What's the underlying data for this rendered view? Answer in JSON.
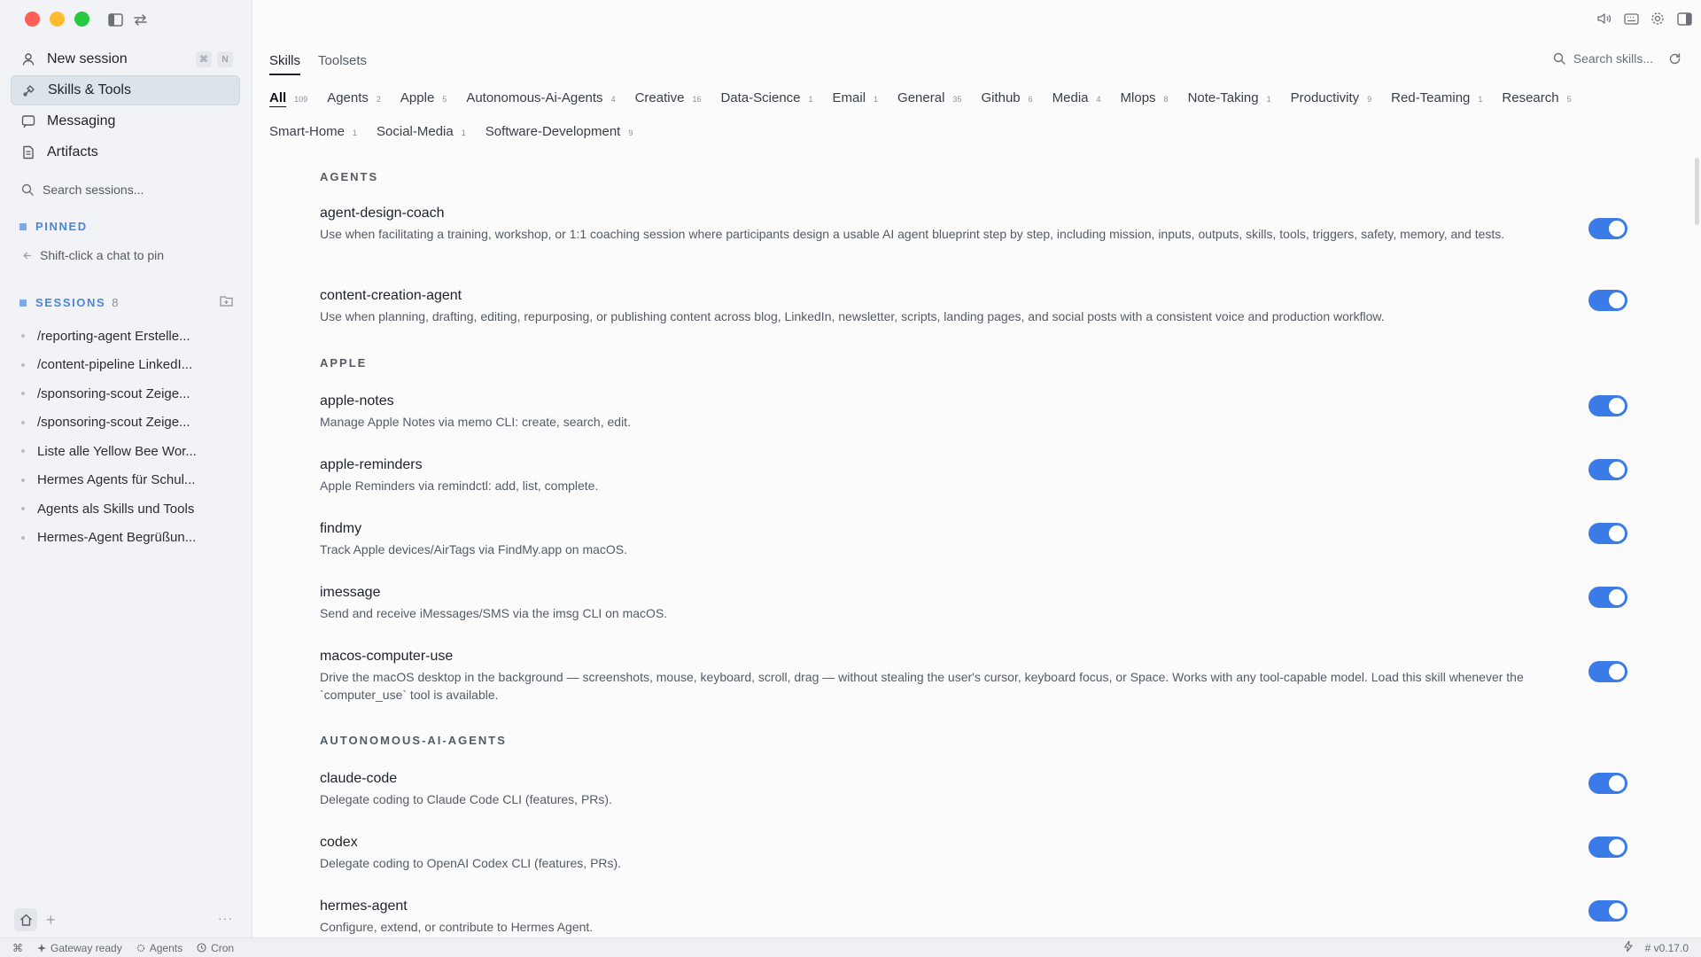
{
  "sidebar": {
    "nav": [
      {
        "label": "New session",
        "icon": "user-icon",
        "kbd": [
          "⌘",
          "N"
        ]
      },
      {
        "label": "Skills & Tools",
        "icon": "skills-icon",
        "active": true
      },
      {
        "label": "Messaging",
        "icon": "message-icon"
      },
      {
        "label": "Artifacts",
        "icon": "file-icon"
      }
    ],
    "search_placeholder": "Search sessions...",
    "pinned_title": "PINNED",
    "pinned_hint": "Shift-click a chat to pin",
    "sessions_title": "SESSIONS",
    "sessions_count": "8",
    "sessions": [
      "/reporting-agent Erstelle...",
      "/content-pipeline LinkedI...",
      "/sponsoring-scout Zeige...",
      "/sponsoring-scout Zeige...",
      "Liste alle Yellow Bee Wor...",
      "Hermes Agents für Schul...",
      "Agents als Skills und Tools",
      "Hermes-Agent Begrüßun..."
    ],
    "more": "···"
  },
  "main": {
    "tabs": [
      {
        "label": "Skills",
        "active": true
      },
      {
        "label": "Toolsets",
        "active": false
      }
    ],
    "search_placeholder": "Search skills...",
    "filters": [
      {
        "label": "All",
        "count": "109",
        "active": true
      },
      {
        "label": "Agents",
        "count": "2"
      },
      {
        "label": "Apple",
        "count": "5"
      },
      {
        "label": "Autonomous-Ai-Agents",
        "count": "4"
      },
      {
        "label": "Creative",
        "count": "16"
      },
      {
        "label": "Data-Science",
        "count": "1"
      },
      {
        "label": "Email",
        "count": "1"
      },
      {
        "label": "General",
        "count": "35"
      },
      {
        "label": "Github",
        "count": "6"
      },
      {
        "label": "Media",
        "count": "4"
      },
      {
        "label": "Mlops",
        "count": "8"
      },
      {
        "label": "Note-Taking",
        "count": "1"
      },
      {
        "label": "Productivity",
        "count": "9"
      },
      {
        "label": "Red-Teaming",
        "count": "1"
      },
      {
        "label": "Research",
        "count": "5"
      },
      {
        "label": "Smart-Home",
        "count": "1"
      },
      {
        "label": "Social-Media",
        "count": "1"
      },
      {
        "label": "Software-Development",
        "count": "9"
      }
    ],
    "categories": [
      {
        "title": "AGENTS",
        "skills": [
          {
            "name": "agent-design-coach",
            "desc": "Use when facilitating a training, workshop, or 1:1 coaching session where participants design a usable AI agent blueprint step by step, including mission, inputs, outputs, skills, tools, triggers, safety, memory, and tests.",
            "enabled": true
          },
          {
            "name": "content-creation-agent",
            "desc": "Use when planning, drafting, editing, repurposing, or publishing content across blog, LinkedIn, newsletter, scripts, landing pages, and social posts with a consistent voice and production workflow.",
            "enabled": true
          }
        ]
      },
      {
        "title": "APPLE",
        "skills": [
          {
            "name": "apple-notes",
            "desc": "Manage Apple Notes via memo CLI: create, search, edit.",
            "enabled": true
          },
          {
            "name": "apple-reminders",
            "desc": "Apple Reminders via remindctl: add, list, complete.",
            "enabled": true
          },
          {
            "name": "findmy",
            "desc": "Track Apple devices/AirTags via FindMy.app on macOS.",
            "enabled": true
          },
          {
            "name": "imessage",
            "desc": "Send and receive iMessages/SMS via the imsg CLI on macOS.",
            "enabled": true
          },
          {
            "name": "macos-computer-use",
            "desc": "Drive the macOS desktop in the background — screenshots, mouse, keyboard, scroll, drag — without stealing the user's cursor, keyboard focus, or Space. Works with any tool-capable model. Load this skill whenever the `computer_use` tool is available.",
            "enabled": true
          }
        ]
      },
      {
        "title": "AUTONOMOUS-AI-AGENTS",
        "skills": [
          {
            "name": "claude-code",
            "desc": "Delegate coding to Claude Code CLI (features, PRs).",
            "enabled": true
          },
          {
            "name": "codex",
            "desc": "Delegate coding to OpenAI Codex CLI (features, PRs).",
            "enabled": true
          },
          {
            "name": "hermes-agent",
            "desc": "Configure, extend, or contribute to Hermes Agent.",
            "enabled": true
          }
        ]
      }
    ]
  },
  "statusbar": {
    "gateway": "Gateway ready",
    "agents": "Agents",
    "cron": "Cron",
    "version": "v0.17.0"
  },
  "colors": {
    "accent": "#3a7be8",
    "section": "#4a86d9"
  }
}
